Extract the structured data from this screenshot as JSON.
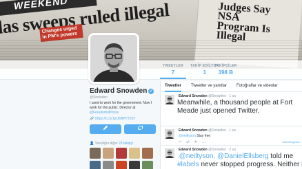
{
  "banner": {
    "paper_word": "WEEKEND",
    "headline": "las sweeps ruled illegal",
    "subhead": "Changes urged in PM's powers",
    "side_headline": "Judges Say NSA Program Is Illegal"
  },
  "profile": {
    "name": "Edward Snowden",
    "handle": "@Snowden",
    "bio_text": "I used to work for the government. Now I work for the public. Director at ",
    "bio_link": "@FreedomofPress",
    "bio_end": ".",
    "url": "https://t.co/1eU6BPYTZ6T",
    "tweet_button_icon": "compose-icon",
    "retweet_button_icon": "retweet-icon",
    "joined_label": "Tanıdığın diğer ",
    "joined_count": "23 takipçi"
  },
  "stats": [
    {
      "label": "TWEETLER",
      "value": "7"
    },
    {
      "label": "TAKİP EDİLYOR",
      "value": "1"
    },
    {
      "label": "TAKİPÇİLER",
      "value": "398 B"
    }
  ],
  "tabs": [
    "Tweetler",
    "Tweetler ve yanıtlar",
    "Fotoğraflar ve videolar"
  ],
  "tweets": [
    {
      "author": "Edward Snowden",
      "meta": "@Snowden · 1 sa",
      "text": "Meanwhile, a thousand people at Fort Meade just opened Twitter."
    },
    {
      "author": "Edward Snowden",
      "meta": "@Snowden · 1 sa",
      "mention": "@neiltyson",
      "text": " Stay free",
      "more": "Sohbeti göster"
    },
    {
      "author": "Edward Snowden",
      "meta": "@Snowden · 2 sa",
      "mention": ".@neiltyson, @DanielEllsberg",
      "text": " told me",
      "line2_tag": "#labels",
      "line2": " never stopped progress. Neither in"
    }
  ],
  "colors": {
    "accent": "#55acee",
    "text": "#292f33",
    "muted": "#8899a6"
  }
}
